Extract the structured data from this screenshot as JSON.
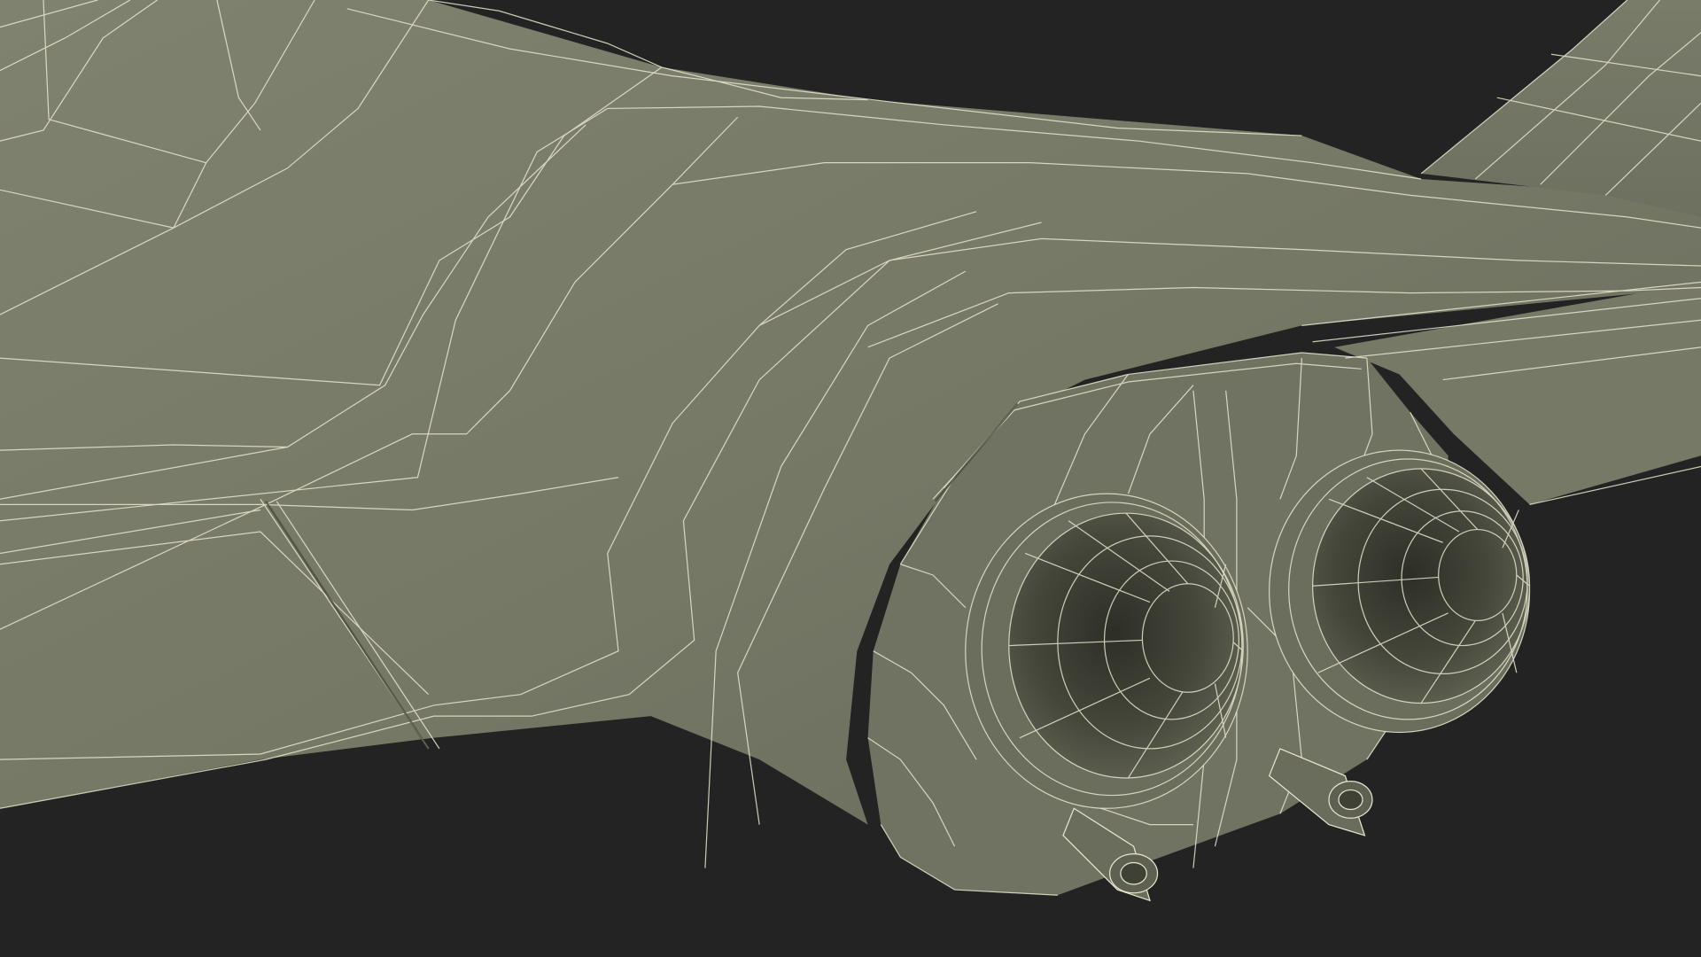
{
  "scene": {
    "subject": "wireframe-3d-model",
    "colors": {
      "background": "#232323",
      "surface_light": "#7c7e6c",
      "surface_mid": "#6f7161",
      "surface_dark": "#5a5c4d",
      "nozzle_inner": "#3d3e33",
      "wire": "#e8e6cf"
    }
  }
}
